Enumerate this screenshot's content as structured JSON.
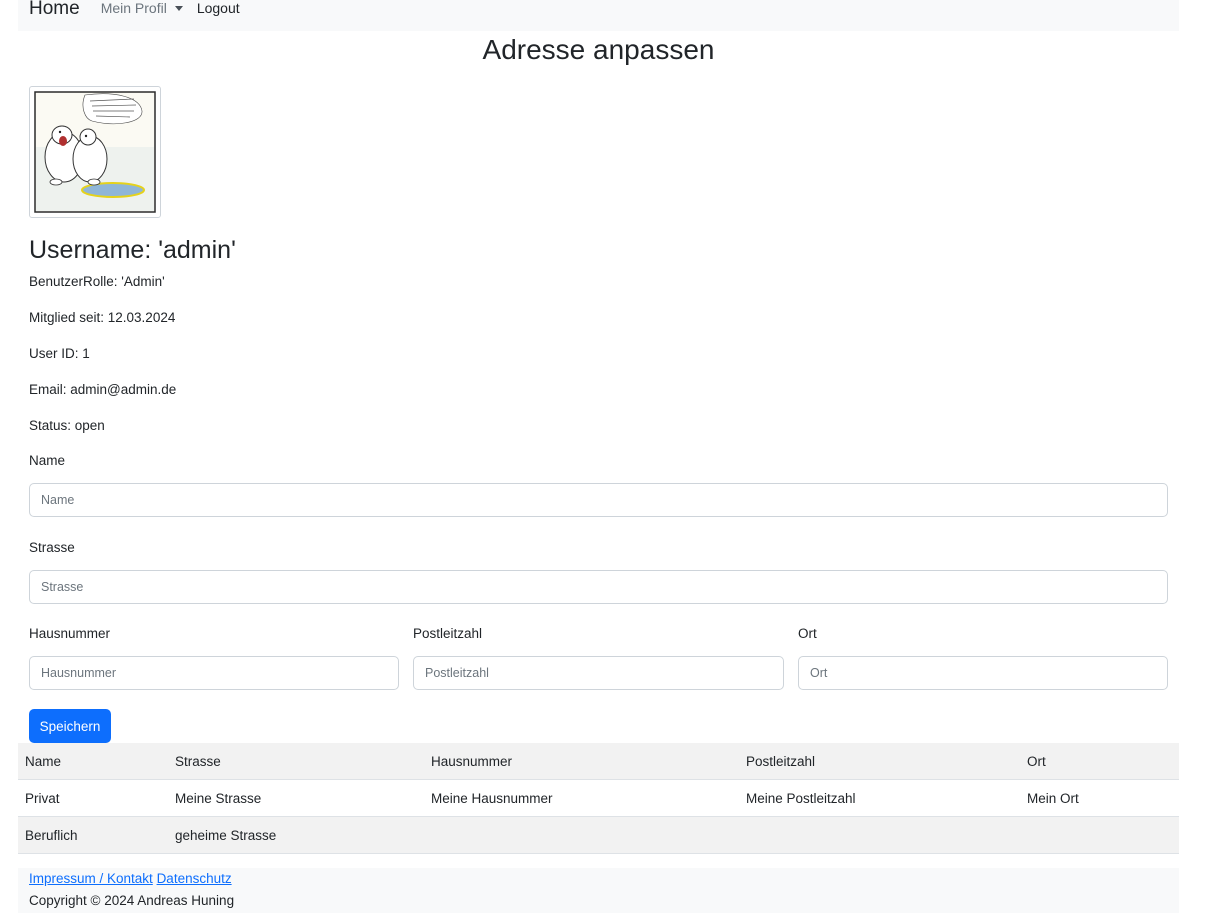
{
  "nav": {
    "brand": "Home",
    "profile_menu": "Mein Profil",
    "logout": "Logout"
  },
  "page": {
    "title": "Adresse anpassen"
  },
  "profile": {
    "username": "Username: 'admin'",
    "role": "BenutzerRolle: 'Admin'",
    "member_since": "Mitglied seit: 12.03.2024",
    "user_id": "User ID: 1",
    "email": "Email: admin@admin.de",
    "status": "Status: open"
  },
  "form": {
    "name": {
      "label": "Name",
      "placeholder": "Name",
      "value": ""
    },
    "strasse": {
      "label": "Strasse",
      "placeholder": "Strasse",
      "value": ""
    },
    "hausnummer": {
      "label": "Hausnummer",
      "placeholder": "Hausnummer",
      "value": ""
    },
    "postleitzahl": {
      "label": "Postleitzahl",
      "placeholder": "Postleitzahl",
      "value": ""
    },
    "ort": {
      "label": "Ort",
      "placeholder": "Ort",
      "value": ""
    },
    "submit": "Speichern"
  },
  "table": {
    "headers": [
      "Name",
      "Strasse",
      "Hausnummer",
      "Postleitzahl",
      "Ort"
    ],
    "rows": [
      [
        "Privat",
        "Meine Strasse",
        "Meine Hausnummer",
        "Meine Postleitzahl",
        "Mein Ort"
      ],
      [
        "Beruflich",
        "geheime Strasse",
        "",
        "",
        ""
      ]
    ]
  },
  "footer": {
    "impressum": "Impressum / Kontakt",
    "datenschutz": "Datenschutz",
    "copyright": "Copyright © 2024 Andreas Huning"
  },
  "colors": {
    "primary": "#0d6efd",
    "navbar_bg": "#f8f9fa",
    "stripe": "#f2f2f2"
  }
}
